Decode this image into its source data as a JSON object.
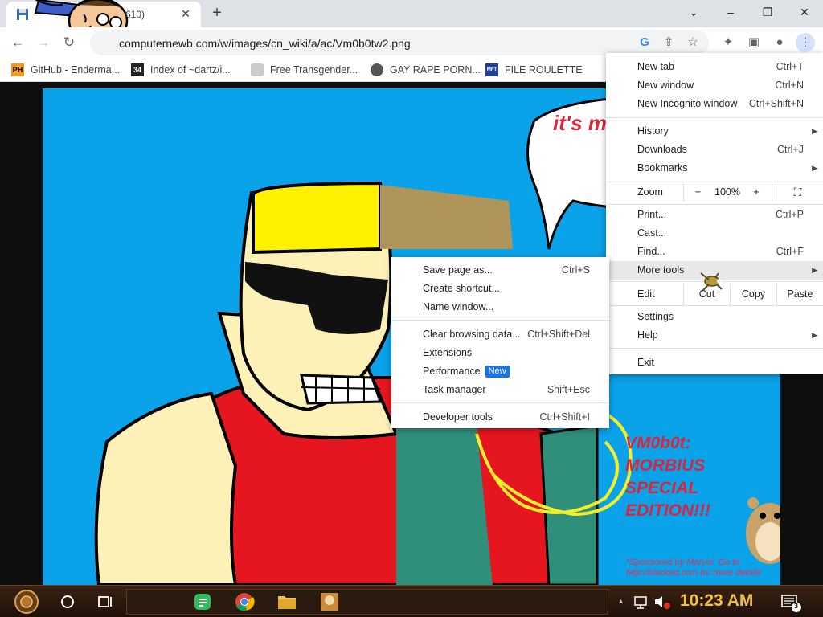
{
  "tab": {
    "title": "610)",
    "close": "✕"
  },
  "new_tab_symbol": "+",
  "window_controls": {
    "minimize": "⌄",
    "min": "–",
    "restore": "❐",
    "close": "✕"
  },
  "omnibox": {
    "url": "computernewb.com/w/images/cn_wiki/a/ac/Vm0b0tw2.png"
  },
  "bookmarks": [
    {
      "icon": "PH",
      "label": "GitHub - Enderma..."
    },
    {
      "icon": "34",
      "label": "Index of ~dartz/i..."
    },
    {
      "icon": "",
      "label": "Free Transgender..."
    },
    {
      "icon": "",
      "label": "GAY RAPE PORN..."
    },
    {
      "icon": "MFT",
      "label": "FILE ROULETTE"
    }
  ],
  "comic": {
    "bubble_text": "it's m",
    "title_lines": [
      "VM0b0t:",
      "MORBIUS",
      "SPECIAL",
      "EDITION!!!"
    ],
    "sponsor_lines": [
      "*Sponsored by Marvel. Go to",
      "http://blacked.com for more details"
    ]
  },
  "menu": {
    "items": [
      {
        "label": "New tab",
        "shortcut": "Ctrl+T"
      },
      {
        "label": "New window",
        "shortcut": "Ctrl+N"
      },
      {
        "label": "New Incognito window",
        "shortcut": "Ctrl+Shift+N"
      },
      {
        "label": "History",
        "shortcut": ""
      },
      {
        "label": "Downloads",
        "shortcut": "Ctrl+J"
      },
      {
        "label": "Bookmarks",
        "shortcut": ""
      },
      {
        "label": "Print...",
        "shortcut": "Ctrl+P"
      },
      {
        "label": "Cast...",
        "shortcut": ""
      },
      {
        "label": "Find...",
        "shortcut": "Ctrl+F"
      },
      {
        "label": "More tools",
        "shortcut": ""
      },
      {
        "label": "Settings",
        "shortcut": ""
      },
      {
        "label": "Help",
        "shortcut": ""
      },
      {
        "label": "Exit",
        "shortcut": ""
      }
    ],
    "zoom": {
      "label": "Zoom",
      "minus": "−",
      "value": "100%",
      "plus": "+"
    },
    "edit": {
      "label": "Edit",
      "cut": "Cut",
      "copy": "Copy",
      "paste": "Paste"
    }
  },
  "submenu": {
    "items": [
      {
        "label": "Save page as...",
        "shortcut": "Ctrl+S"
      },
      {
        "label": "Create shortcut...",
        "shortcut": ""
      },
      {
        "label": "Name window...",
        "shortcut": ""
      },
      {
        "label": "Clear browsing data...",
        "shortcut": "Ctrl+Shift+Del"
      },
      {
        "label": "Extensions",
        "shortcut": ""
      },
      {
        "label": "Performance",
        "shortcut": "",
        "badge": "New"
      },
      {
        "label": "Task manager",
        "shortcut": "Shift+Esc"
      },
      {
        "label": "Developer tools",
        "shortcut": "Ctrl+Shift+I"
      }
    ]
  },
  "taskbar": {
    "time": "10:23 AM",
    "notification_count": "3"
  },
  "colors": {
    "accent": "#1a73e8",
    "comic_sky": "#0aa2e8",
    "comic_red": "#d7263d",
    "clock": "#f0c03a"
  }
}
